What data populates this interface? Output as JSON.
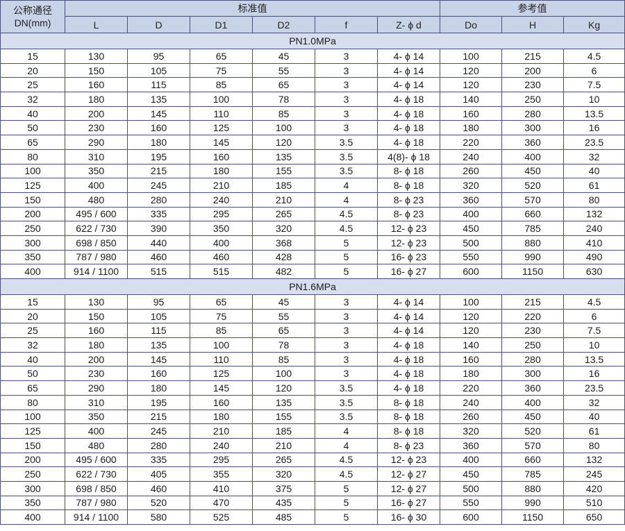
{
  "header": {
    "dn_label": "公称通径",
    "dn_sub": "DN(mm)",
    "standard_group": "标准值",
    "reference_group": "参考值",
    "columns": [
      "L",
      "D",
      "D1",
      "D2",
      "f",
      "Z- ϕ d",
      "Do",
      "H",
      "Kg"
    ]
  },
  "sections": [
    {
      "title": "PN1.0MPa",
      "rows": [
        [
          "15",
          "130",
          "95",
          "65",
          "45",
          "3",
          "4- ϕ 14",
          "100",
          "215",
          "4.5"
        ],
        [
          "20",
          "150",
          "105",
          "75",
          "55",
          "3",
          "4- ϕ 14",
          "120",
          "200",
          "6"
        ],
        [
          "25",
          "160",
          "115",
          "85",
          "65",
          "3",
          "4- ϕ 14",
          "120",
          "230",
          "7.5"
        ],
        [
          "32",
          "180",
          "135",
          "100",
          "78",
          "3",
          "4- ϕ 18",
          "140",
          "250",
          "10"
        ],
        [
          "40",
          "200",
          "145",
          "110",
          "85",
          "3",
          "4- ϕ 18",
          "160",
          "280",
          "13.5"
        ],
        [
          "50",
          "230",
          "160",
          "125",
          "100",
          "3",
          "4- ϕ 18",
          "180",
          "300",
          "16"
        ],
        [
          "65",
          "290",
          "180",
          "145",
          "120",
          "3.5",
          "4- ϕ 18",
          "220",
          "360",
          "23.5"
        ],
        [
          "80",
          "310",
          "195",
          "160",
          "135",
          "3.5",
          "4(8)- ϕ 18",
          "240",
          "400",
          "32"
        ],
        [
          "100",
          "350",
          "215",
          "180",
          "155",
          "3.5",
          "8- ϕ 18",
          "260",
          "450",
          "40"
        ],
        [
          "125",
          "400",
          "245",
          "210",
          "185",
          "4",
          "8- ϕ 18",
          "320",
          "520",
          "61"
        ],
        [
          "150",
          "480",
          "280",
          "240",
          "210",
          "4",
          "8- ϕ 23",
          "360",
          "570",
          "80"
        ],
        [
          "200",
          "495 / 600",
          "335",
          "295",
          "265",
          "4.5",
          "8- ϕ 23",
          "400",
          "660",
          "132"
        ],
        [
          "250",
          "622 / 730",
          "390",
          "350",
          "320",
          "4.5",
          "12- ϕ 23",
          "450",
          "785",
          "240"
        ],
        [
          "300",
          "698 / 850",
          "440",
          "400",
          "368",
          "5",
          "12- ϕ 23",
          "500",
          "880",
          "410"
        ],
        [
          "350",
          "787 / 980",
          "460",
          "460",
          "428",
          "5",
          "16- ϕ 23",
          "550",
          "990",
          "490"
        ],
        [
          "400",
          "914 / 1100",
          "515",
          "515",
          "482",
          "5",
          "16- ϕ 27",
          "600",
          "1150",
          "630"
        ]
      ]
    },
    {
      "title": "PN1.6MPa",
      "rows": [
        [
          "15",
          "130",
          "95",
          "65",
          "45",
          "3",
          "4- ϕ 14",
          "100",
          "215",
          "4.5"
        ],
        [
          "20",
          "150",
          "105",
          "75",
          "55",
          "3",
          "4- ϕ 14",
          "120",
          "220",
          "6"
        ],
        [
          "25",
          "160",
          "115",
          "85",
          "65",
          "3",
          "4- ϕ 14",
          "120",
          "230",
          "7.5"
        ],
        [
          "32",
          "180",
          "135",
          "100",
          "78",
          "3",
          "4- ϕ 18",
          "140",
          "250",
          "10"
        ],
        [
          "40",
          "200",
          "145",
          "110",
          "85",
          "3",
          "4- ϕ 18",
          "160",
          "280",
          "13.5"
        ],
        [
          "50",
          "230",
          "160",
          "125",
          "100",
          "3",
          "4- ϕ 18",
          "180",
          "300",
          "16"
        ],
        [
          "65",
          "290",
          "180",
          "145",
          "120",
          "3.5",
          "4- ϕ 18",
          "220",
          "360",
          "23.5"
        ],
        [
          "80",
          "310",
          "195",
          "160",
          "135",
          "3.5",
          "8- ϕ 18",
          "240",
          "400",
          "32"
        ],
        [
          "100",
          "350",
          "215",
          "180",
          "155",
          "3.5",
          "8- ϕ 18",
          "260",
          "450",
          "40"
        ],
        [
          "125",
          "400",
          "245",
          "210",
          "185",
          "4",
          "8- ϕ 18",
          "320",
          "520",
          "61"
        ],
        [
          "150",
          "480",
          "280",
          "240",
          "210",
          "4",
          "8- ϕ 23",
          "360",
          "570",
          "80"
        ],
        [
          "200",
          "495 / 600",
          "335",
          "295",
          "265",
          "4.5",
          "12- ϕ 23",
          "400",
          "660",
          "132"
        ],
        [
          "250",
          "622 / 730",
          "405",
          "355",
          "320",
          "4.5",
          "12- ϕ 27",
          "450",
          "785",
          "245"
        ],
        [
          "300",
          "698 / 850",
          "460",
          "410",
          "375",
          "5",
          "12- ϕ 27",
          "500",
          "880",
          "420"
        ],
        [
          "350",
          "787 / 980",
          "520",
          "470",
          "435",
          "5",
          "16- ϕ 27",
          "550",
          "990",
          "510"
        ],
        [
          "400",
          "914 / 1100",
          "580",
          "525",
          "485",
          "5",
          "16- ϕ 30",
          "600",
          "1150",
          "650"
        ]
      ]
    }
  ]
}
